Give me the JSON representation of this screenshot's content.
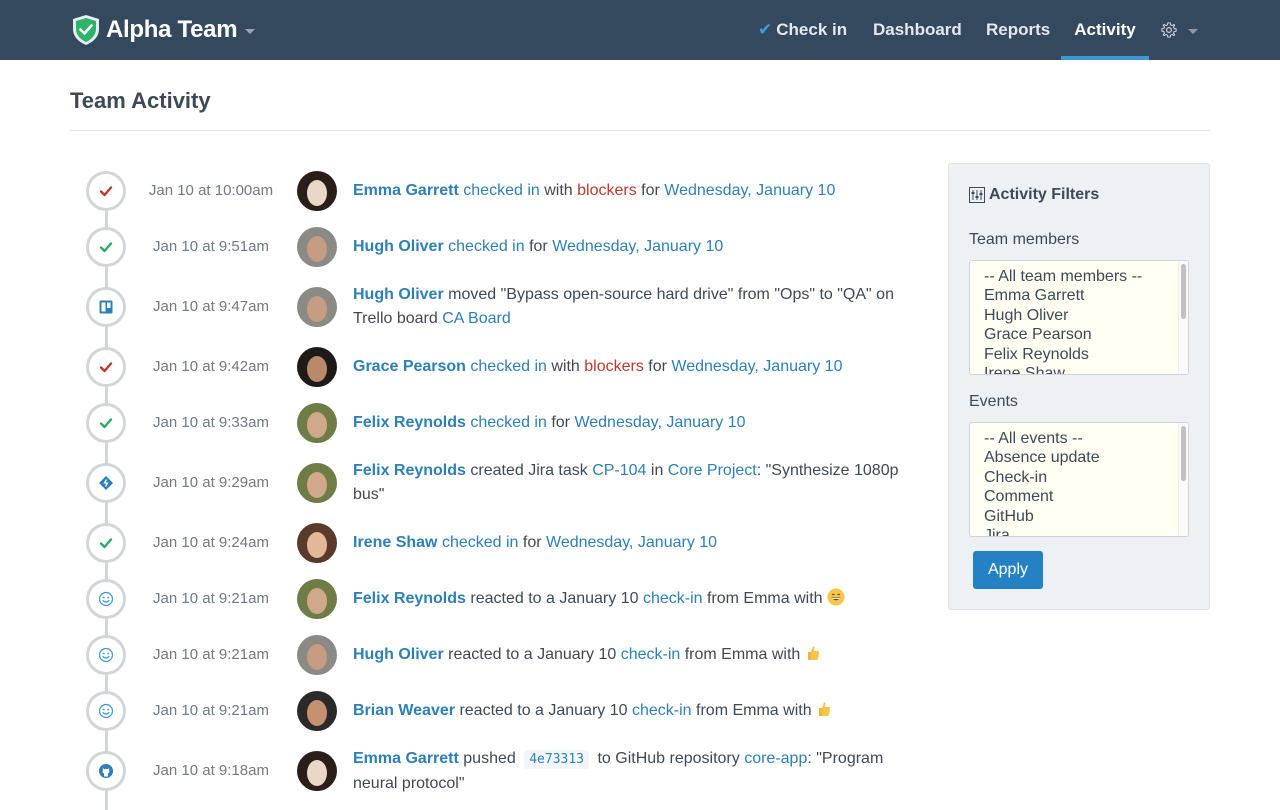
{
  "app": {
    "brand_name": "Alpha Team",
    "colors": {
      "navbar": "#34495e",
      "accent": "#2c7fb8",
      "blocker": "#c0392b",
      "success": "#27ae60",
      "active_underline": "#3d97d3"
    }
  },
  "nav": {
    "items": [
      {
        "label": "Check in",
        "icon": "checkmark-icon"
      },
      {
        "label": "Dashboard"
      },
      {
        "label": "Reports"
      },
      {
        "label": "Activity",
        "active": true
      }
    ],
    "settings_icon": "gear-icon"
  },
  "page": {
    "title": "Team Activity"
  },
  "events": [
    {
      "time": "Jan 10 at 10:00am",
      "icon": "check-red",
      "person": "Emma Garrett",
      "parts": [
        "checked in",
        " with ",
        "blockers",
        " for ",
        "Wednesday, January 10"
      ]
    },
    {
      "time": "Jan 10 at 9:51am",
      "icon": "check-green",
      "person": "Hugh Oliver",
      "parts": [
        "checked in",
        " for ",
        "Wednesday, January 10"
      ]
    },
    {
      "time": "Jan 10 at 9:47am",
      "icon": "trello",
      "person": "Hugh Oliver",
      "parts": [
        " moved \"Bypass open-source hard drive\" from \"Ops\" to \"QA\" on Trello board ",
        "CA Board"
      ]
    },
    {
      "time": "Jan 10 at 9:42am",
      "icon": "check-red",
      "person": "Grace Pearson",
      "parts": [
        "checked in",
        " with ",
        "blockers",
        " for ",
        "Wednesday, January 10"
      ]
    },
    {
      "time": "Jan 10 at 9:33am",
      "icon": "check-green",
      "person": "Felix Reynolds",
      "parts": [
        "checked in",
        " for ",
        "Wednesday, January 10"
      ]
    },
    {
      "time": "Jan 10 at 9:29am",
      "icon": "jira",
      "person": "Felix Reynolds",
      "parts": [
        " created Jira task ",
        "CP-104",
        " in ",
        "Core Project",
        ": \"Synthesize 1080p bus\""
      ]
    },
    {
      "time": "Jan 10 at 9:24am",
      "icon": "check-green",
      "person": "Irene Shaw",
      "parts": [
        "checked in",
        " for ",
        "Wednesday, January 10"
      ]
    },
    {
      "time": "Jan 10 at 9:21am",
      "icon": "smiley",
      "person": "Felix Reynolds",
      "parts": [
        " reacted to a January 10 ",
        "check-in",
        " from Emma with "
      ],
      "reaction": "grinning-emoji"
    },
    {
      "time": "Jan 10 at 9:21am",
      "icon": "smiley",
      "person": "Hugh Oliver",
      "parts": [
        " reacted to a January 10 ",
        "check-in",
        " from Emma with "
      ],
      "reaction": "thumbs-up-emoji"
    },
    {
      "time": "Jan 10 at 9:21am",
      "icon": "smiley",
      "person": "Brian Weaver",
      "parts": [
        " reacted to a January 10 ",
        "check-in",
        " from Emma with "
      ],
      "reaction": "thumbs-up-emoji"
    },
    {
      "time": "Jan 10 at 9:18am",
      "icon": "github",
      "person": "Emma Garrett",
      "parts": [
        " pushed ",
        "4e73313",
        " to GitHub repository ",
        "core-app",
        ": \"Program neural protocol\""
      ]
    }
  ],
  "filters": {
    "title": "Activity Filters",
    "team_label": "Team members",
    "team_options": [
      "-- All team members --",
      "Emma Garrett",
      "Hugh Oliver",
      "Grace Pearson",
      "Felix Reynolds",
      "Irene Shaw"
    ],
    "events_label": "Events",
    "event_options": [
      "-- All events --",
      "Absence update",
      "Check-in",
      "Comment",
      "GitHub",
      "Jira"
    ],
    "apply_label": "Apply"
  }
}
